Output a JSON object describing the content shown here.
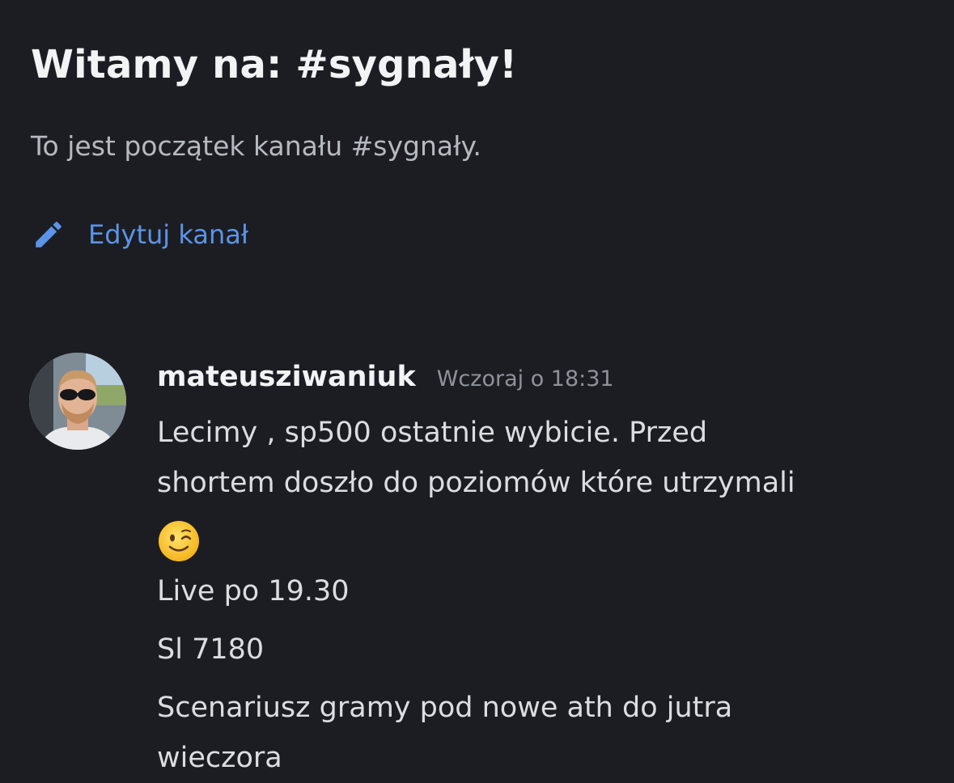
{
  "welcome": {
    "title": "Witamy na: #sygnały!",
    "subtitle": "To jest początek kanału #sygnały.",
    "edit_label": "Edytuj kanał",
    "edit_icon": "pencil-icon",
    "accent_color": "#5b94e8"
  },
  "message": {
    "username": "mateusziwaniuk",
    "timestamp": "Wczoraj o 18:31",
    "avatar_icon": "user-avatar",
    "lines": [
      "Lecimy , sp500 ostatnie wybicie. Przed",
      "shortem doszło do poziomów które utrzymali",
      "Live po 19.30",
      "Sl 7180",
      "Scenariusz gramy pod nowe ath do jutra",
      "wieczora"
    ],
    "emoji": "winking-face-emoji"
  },
  "colors": {
    "background": "#1c1d22",
    "text_primary": "#f2f3f5",
    "text_secondary": "#b5b9c0",
    "timestamp": "#8e929a"
  }
}
